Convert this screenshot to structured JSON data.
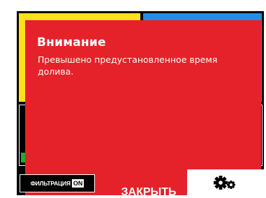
{
  "tiles": {
    "yellow_color": "#ffe01c",
    "blue_color": "#1e90e6",
    "level_indicator_color": "#19b02c"
  },
  "dialog": {
    "title": "Внимание",
    "message": "Превышено предустановленное время долива.",
    "background_color": "#e5222a",
    "close_label": "ЗАКРЫТЬ"
  },
  "footer": {
    "filter_label": "ФИЛЬТРАЦИЯ",
    "filter_state": "ON",
    "settings_icon": "gears-icon"
  }
}
